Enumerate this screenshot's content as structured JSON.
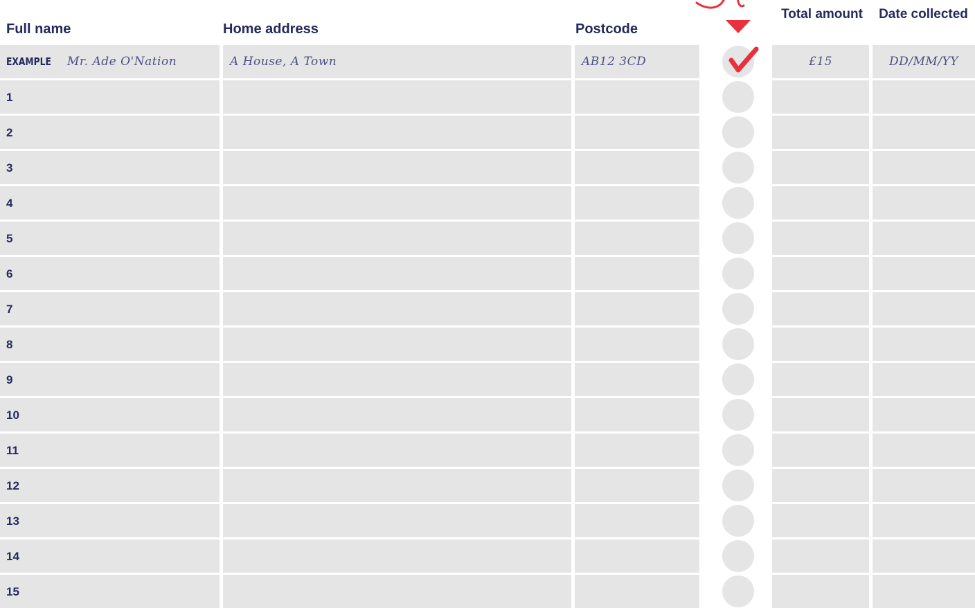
{
  "header": {
    "full_name": "Full name",
    "home_address": "Home address",
    "postcode": "Postcode",
    "total_amount": "Total amount",
    "date_collected": "Date collected"
  },
  "example": {
    "tag": "EXAMPLE",
    "name": "Mr. Ade O'Nation",
    "address": "A House, A Town",
    "postcode": "AB12 3CD",
    "gift_aid": "checked",
    "total": "£15",
    "date": "DD/MM/YY"
  },
  "rows": [
    "1",
    "2",
    "3",
    "4",
    "5",
    "6",
    "7",
    "8",
    "9",
    "10",
    "11",
    "12",
    "13",
    "14",
    "15"
  ],
  "colors": {
    "navy": "#232a5c",
    "cell": "#e5e5e6",
    "accent_red": "#e8313c"
  },
  "icons": {
    "gift_aid_marker": "down-triangle-icon",
    "example_check": "checkmark-icon"
  }
}
